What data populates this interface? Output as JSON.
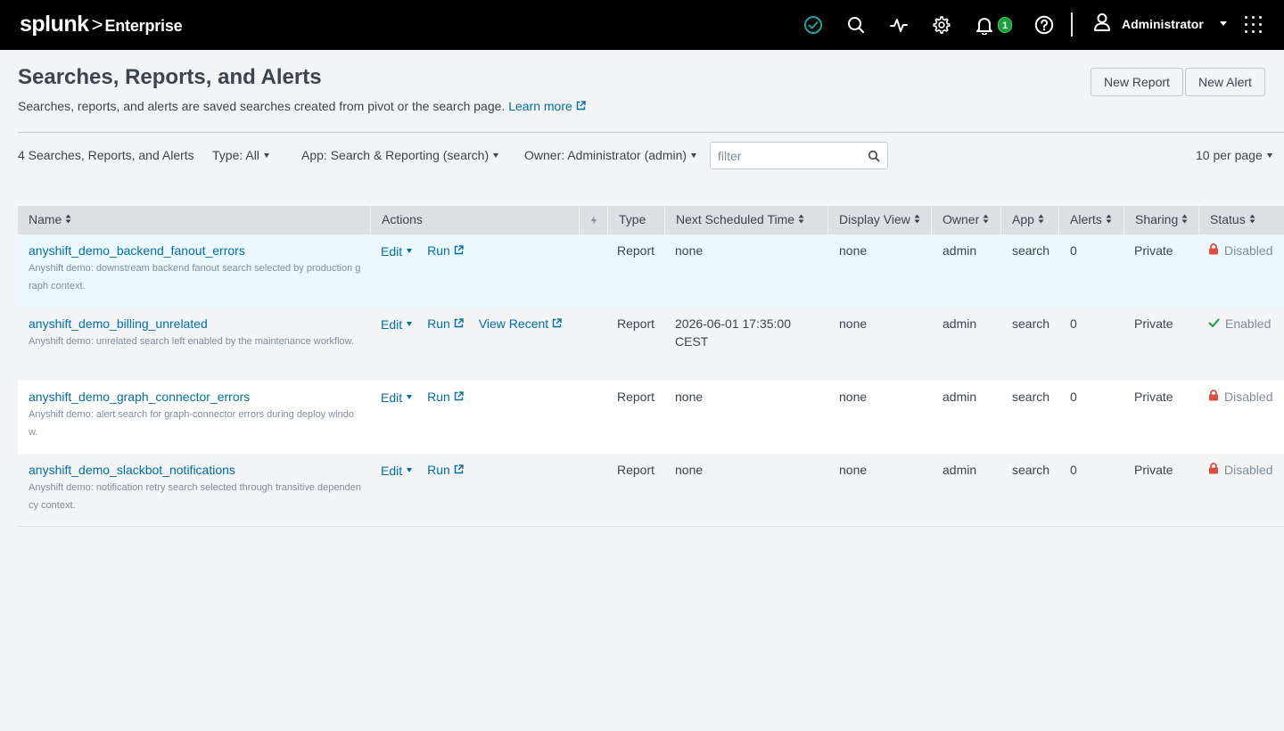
{
  "topbar": {
    "brand": "splunk",
    "separator": ">",
    "product": "Enterprise",
    "notifications_count": "1",
    "user_name": "Administrator"
  },
  "header": {
    "title": "Searches, Reports, and Alerts",
    "description": "Searches, reports, and alerts are saved searches created from pivot or the search page.",
    "learn_more": "Learn more",
    "new_report": "New Report",
    "new_alert": "New Alert"
  },
  "controls": {
    "count": "4 Searches, Reports, and Alerts",
    "type_filter": "Type: All",
    "app_filter": "App: Search & Reporting (search)",
    "owner_filter": "Owner: Administrator (admin)",
    "filter_placeholder": "filter",
    "per_page": "10 per page"
  },
  "table": {
    "columns": {
      "name": "Name",
      "actions": "Actions",
      "type": "Type",
      "next_scheduled": "Next Scheduled Time",
      "display_view": "Display View",
      "owner": "Owner",
      "app": "App",
      "alerts": "Alerts",
      "sharing": "Sharing",
      "status": "Status"
    },
    "rows": [
      {
        "name": "anyshift_demo_backend_fanout_errors",
        "description": "Anyshift demo: downstream backend fanout search selected by production graph context.",
        "edit": "Edit",
        "run": "Run",
        "view_recent": "",
        "type": "Report",
        "next_scheduled": "none",
        "display_view": "none",
        "owner": "admin",
        "app": "search",
        "alerts": "0",
        "sharing": "Private",
        "status": "Disabled"
      },
      {
        "name": "anyshift_demo_billing_unrelated",
        "description": "Anyshift demo: unrelated search left enabled by the maintenance workflow.",
        "edit": "Edit",
        "run": "Run",
        "view_recent": "View Recent",
        "type": "Report",
        "next_scheduled": "2026-06-01 17:35:00 CEST",
        "display_view": "none",
        "owner": "admin",
        "app": "search",
        "alerts": "0",
        "sharing": "Private",
        "status": "Enabled"
      },
      {
        "name": "anyshift_demo_graph_connector_errors",
        "description": "Anyshift demo: alert search for graph-connector errors during deploy window.",
        "edit": "Edit",
        "run": "Run",
        "view_recent": "",
        "type": "Report",
        "next_scheduled": "none",
        "display_view": "none",
        "owner": "admin",
        "app": "search",
        "alerts": "0",
        "sharing": "Private",
        "status": "Disabled"
      },
      {
        "name": "anyshift_demo_slackbot_notifications",
        "description": "Anyshift demo: notification retry search selected through transitive dependency context.",
        "edit": "Edit",
        "run": "Run",
        "view_recent": "",
        "type": "Report",
        "next_scheduled": "none",
        "display_view": "none",
        "owner": "admin",
        "app": "search",
        "alerts": "0",
        "sharing": "Private",
        "status": "Disabled"
      }
    ]
  },
  "colors": {
    "link": "#006eaa",
    "disabled_lock": "#dc4e41",
    "enabled_check": "#1a9c3e",
    "health_ok": "#1a9c9c"
  }
}
